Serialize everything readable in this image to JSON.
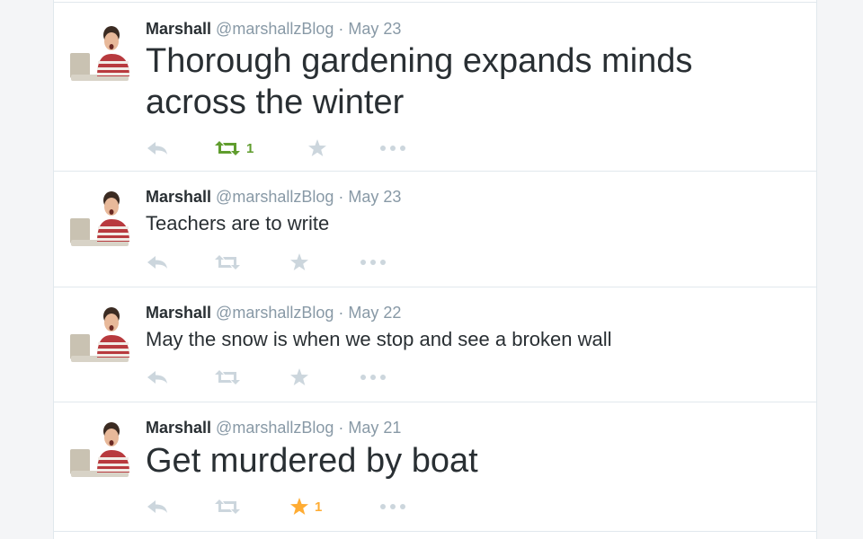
{
  "colors": {
    "action_gray": "#ccd6dd",
    "retweet_active": "#609d2e",
    "favorite_active": "#ffac33"
  },
  "tweets": [
    {
      "fullname": "Marshall",
      "username": "@marshallzBlog",
      "separator": "·",
      "time": "May 23",
      "text": "Thorough gardening expands minds across the winter",
      "retweets": "1",
      "favorites": "",
      "retweeted": true,
      "favorited": false
    },
    {
      "fullname": "Marshall",
      "username": "@marshallzBlog",
      "separator": "·",
      "time": "May 23",
      "text": "Teachers are to write",
      "retweets": "",
      "favorites": "",
      "retweeted": false,
      "favorited": false
    },
    {
      "fullname": "Marshall",
      "username": "@marshallzBlog",
      "separator": "·",
      "time": "May 22",
      "text": "May the snow is when we stop and see a broken wall",
      "retweets": "",
      "favorites": "",
      "retweeted": false,
      "favorited": false
    },
    {
      "fullname": "Marshall",
      "username": "@marshallzBlog",
      "separator": "·",
      "time": "May 21",
      "text": "Get murdered by boat",
      "retweets": "",
      "favorites": "1",
      "retweeted": false,
      "favorited": true
    }
  ]
}
